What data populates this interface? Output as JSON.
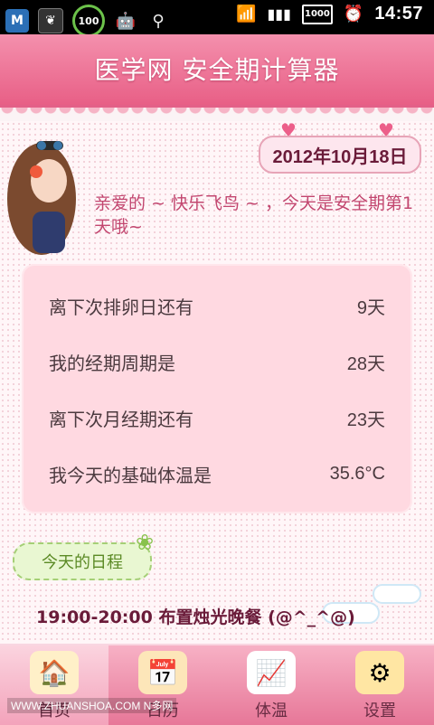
{
  "status_bar": {
    "battery_level": "100",
    "time": "14:57",
    "hd_badge": "1000"
  },
  "header": {
    "title": "医学网 安全期计算器"
  },
  "date": "2012年10月18日",
  "greeting": "亲爱的 ~ 快乐飞鸟 ~ ，今天是安全期第1天哦~",
  "info": [
    {
      "label": "离下次排卵日还有",
      "value": "9天"
    },
    {
      "label": "我的经期周期是",
      "value": "28天"
    },
    {
      "label": "离下次月经期还有",
      "value": "23天"
    },
    {
      "label": "我今天的基础体温是",
      "value": "35.6°C"
    }
  ],
  "schedule": {
    "title": "今天的日程",
    "item": "19:00-20:00 布置烛光晚餐 (@^_^@)"
  },
  "nav": [
    {
      "label": "首页",
      "icon": "home-icon",
      "active": true
    },
    {
      "label": "日历",
      "icon": "calendar-icon",
      "active": false
    },
    {
      "label": "体温",
      "icon": "thermometer-chart-icon",
      "active": false
    },
    {
      "label": "设置",
      "icon": "gear-icon",
      "active": false
    }
  ],
  "watermark": "WWW.ZHUANSHOA.COM N多网",
  "colors": {
    "header": "#e85f86",
    "panel": "#ffd9e1",
    "accent_text": "#c2466f"
  }
}
